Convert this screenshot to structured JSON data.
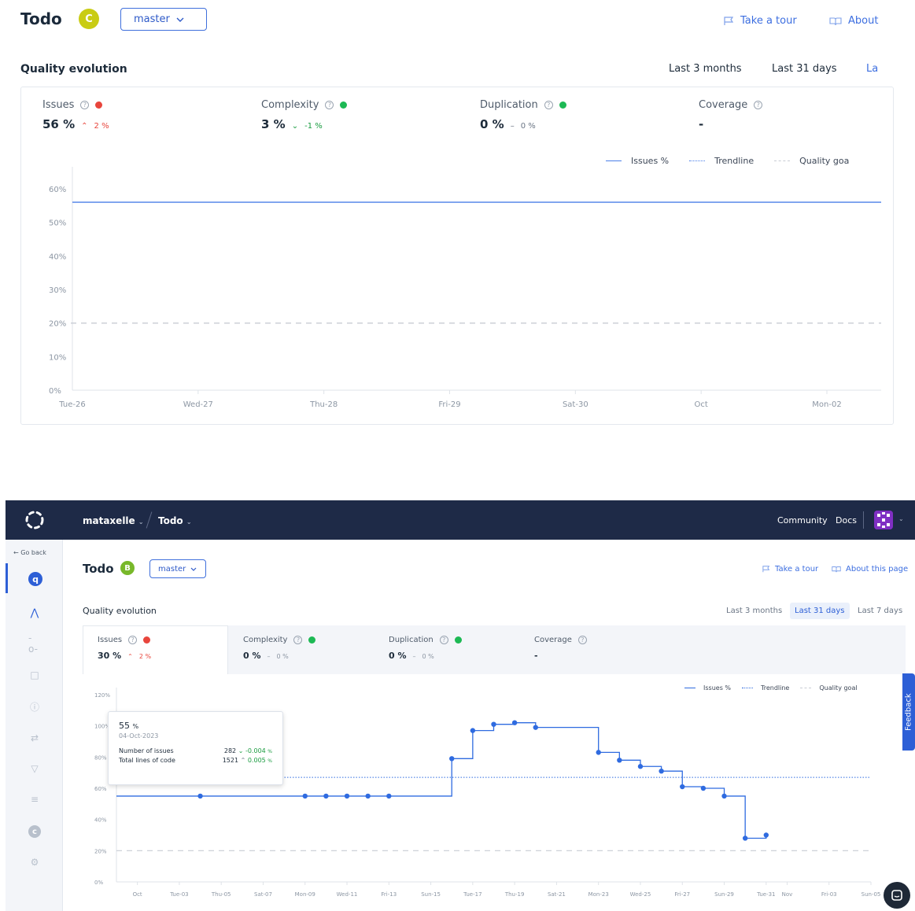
{
  "top": {
    "title": "Todo",
    "grade": "C",
    "branch": "master",
    "take_tour": "Take a tour",
    "about": "About",
    "section_title": "Quality evolution",
    "periods": [
      "Last 3 months",
      "Last 31 days",
      "La"
    ],
    "metrics": [
      {
        "name": "Issues",
        "status_color": "#e8453c",
        "value": "56 %",
        "delta": "2 %",
        "delta_dir": "up",
        "delta_color": "#e8453c"
      },
      {
        "name": "Complexity",
        "status_color": "#1db954",
        "value": "3 %",
        "delta": "-1 %",
        "delta_dir": "down",
        "delta_color": "#1a9c40"
      },
      {
        "name": "Duplication",
        "status_color": "#1db954",
        "value": "0 %",
        "delta": "0 %",
        "delta_dir": "flat",
        "delta_color": "#6b7685"
      },
      {
        "name": "Coverage",
        "status_color": "",
        "value": "-",
        "delta": "",
        "delta_dir": "",
        "delta_color": ""
      }
    ],
    "legend": [
      "Issues %",
      "Trendline",
      "Quality goa"
    ]
  },
  "bottom": {
    "nav": {
      "org": "mataxelle",
      "project": "Todo",
      "community": "Community",
      "docs": "Docs"
    },
    "go_back": "Go back",
    "title": "Todo",
    "grade": "B",
    "branch": "master",
    "take_tour": "Take a tour",
    "about": "About this page",
    "section_title": "Quality evolution",
    "periods": [
      "Last 3 months",
      "Last 31 days",
      "Last 7 days"
    ],
    "active_period": "Last 31 days",
    "metrics": [
      {
        "name": "Issues",
        "status_color": "#e8453c",
        "value": "30 %",
        "delta": "2 %",
        "delta_dir": "up",
        "delta_color": "#e8453c"
      },
      {
        "name": "Complexity",
        "status_color": "#1db954",
        "value": "0 %",
        "delta": "0 %",
        "delta_dir": "flat",
        "delta_color": "#8c96a3"
      },
      {
        "name": "Duplication",
        "status_color": "#1db954",
        "value": "0 %",
        "delta": "0 %",
        "delta_dir": "flat",
        "delta_color": "#8c96a3"
      },
      {
        "name": "Coverage",
        "status_color": "",
        "value": "-",
        "delta": "",
        "delta_dir": "",
        "delta_color": ""
      }
    ],
    "legend": [
      "Issues %",
      "Trendline",
      "Quality goal"
    ],
    "tooltip": {
      "value": "55",
      "unit": "%",
      "date": "04-Oct-2023",
      "rows": [
        {
          "label": "Number of issues",
          "value": "282",
          "dir": "down",
          "delta": "-0.004",
          "unit": "%",
          "color": "#1a9c40"
        },
        {
          "label": "Total lines of code",
          "value": "1521",
          "dir": "up",
          "delta": "0.005",
          "unit": "%",
          "color": "#1a9c40"
        }
      ]
    },
    "feedback": "Feedback"
  },
  "chart_data": [
    {
      "type": "line",
      "title": "",
      "xlabel": "",
      "ylabel": "",
      "ylim": [
        0,
        60
      ],
      "y_ticks": [
        "0%",
        "10%",
        "20%",
        "30%",
        "40%",
        "50%",
        "60%"
      ],
      "x_ticks": [
        "Tue-26",
        "Wed-27",
        "Thu-28",
        "Fri-29",
        "Sat-30",
        "Oct",
        "Mon-02"
      ],
      "series": [
        {
          "name": "Issues %",
          "color": "#4a7ee8",
          "style": "solid",
          "x": [
            0,
            6.4
          ],
          "values": [
            56,
            56
          ]
        },
        {
          "name": "Quality goal",
          "color": "#c8ccd4",
          "style": "dashed",
          "x": [
            0,
            6.4
          ],
          "values": [
            20,
            20
          ]
        }
      ],
      "grid": false,
      "legend_position": "top-right"
    },
    {
      "type": "line",
      "title": "",
      "xlabel": "",
      "ylabel": "",
      "ylim": [
        0,
        120
      ],
      "y_ticks": [
        "0%",
        "20%",
        "40%",
        "60%",
        "80%",
        "100%",
        "120%"
      ],
      "x_ticks": [
        "Oct",
        "Tue-03",
        "Thu-05",
        "Sat-07",
        "Mon-09",
        "Wed-11",
        "Fri-13",
        "Sun-15",
        "Tue-17",
        "Thu-19",
        "Sat-21",
        "Mon-23",
        "Wed-25",
        "Fri-27",
        "Sun-29",
        "Tue-31",
        "Nov",
        "Fri-03",
        "Sun-05"
      ],
      "x_tick_pos": [
        1,
        3,
        5,
        7,
        9,
        11,
        13,
        15,
        17,
        19,
        21,
        23,
        25,
        27,
        29,
        31,
        32,
        34,
        36
      ],
      "x_range": [
        0.0,
        36.0
      ],
      "series": [
        {
          "name": "Issues %",
          "color": "#2f6be0",
          "style": "step",
          "x": [
            0.0,
            4.0,
            9.0,
            10.0,
            11.0,
            12.0,
            13.0,
            16.0,
            17.0,
            18.0,
            19.0,
            20.0,
            23.0,
            24.0,
            25.0,
            26.0,
            27.0,
            28.0,
            29.0,
            30.0,
            31.0
          ],
          "values": [
            55,
            55,
            55,
            55,
            55,
            55,
            55,
            79,
            97,
            101,
            102,
            99,
            83,
            78,
            74,
            71,
            61,
            60,
            55,
            28,
            30
          ],
          "markers_from": 1
        },
        {
          "name": "Trendline",
          "color": "#2f6be0",
          "style": "dotted",
          "x": [
            0.0,
            36.0
          ],
          "values": [
            67,
            67
          ]
        },
        {
          "name": "Quality goal",
          "color": "#c8ccd4",
          "style": "dashed",
          "x": [
            0.0,
            36.0
          ],
          "values": [
            20,
            20
          ]
        }
      ],
      "grid": false,
      "legend_position": "top-right"
    }
  ]
}
